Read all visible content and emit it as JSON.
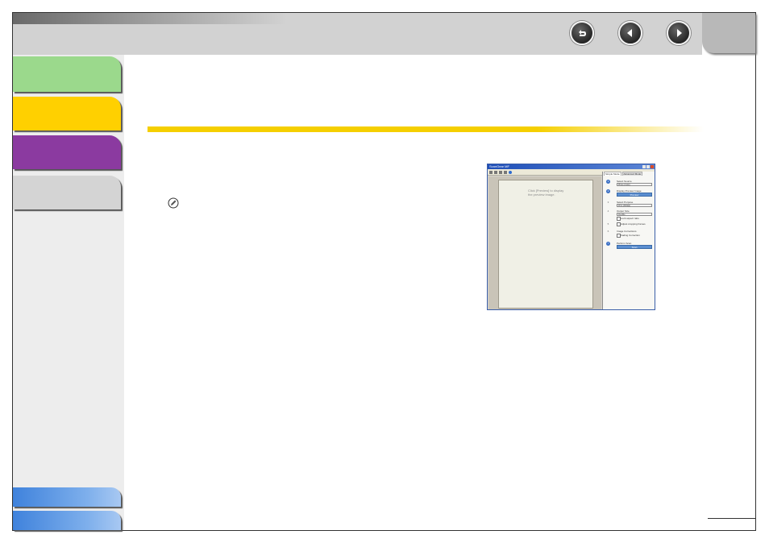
{
  "screenshot": {
    "title_bar": "ScanGear MF",
    "page_hint_line1": "Click [Preview] to display",
    "page_hint_line2": "the preview image.",
    "tabs": [
      "Simple Mode",
      "Advanced Mode"
    ],
    "steps": [
      {
        "num": "1",
        "label": "Select Source",
        "value": "Photo (Color)"
      },
      {
        "num": "2",
        "label": "Display Preview Image",
        "button": "Preview"
      },
      {
        "num": "3",
        "label": "Select Purpose",
        "value": "Print (300dpi)"
      },
      {
        "num": "4",
        "label": "Output Size",
        "value": "Flexible",
        "checkbox": "Lock aspect ratio"
      },
      {
        "num": "5",
        "checkbox": "Adjust cropping frames"
      },
      {
        "num": "6",
        "label": "Image Corrections",
        "checkbox": "Fading Correction"
      },
      {
        "num": "7",
        "label": "Perform Scan",
        "button": "Scan"
      }
    ]
  },
  "colors": {
    "section_green": "#9bd98c",
    "section_yellow": "#ffd000",
    "section_purple": "#8b3aa0",
    "section_gray": "#d4d4d4",
    "bottom_blue": "#3f82dc",
    "accent_rule": "#f5cf00"
  },
  "icons": {
    "back": "return-arrow-icon",
    "previous": "arrow-left-icon",
    "next": "arrow-right-icon",
    "note": "pencil-note-icon"
  }
}
